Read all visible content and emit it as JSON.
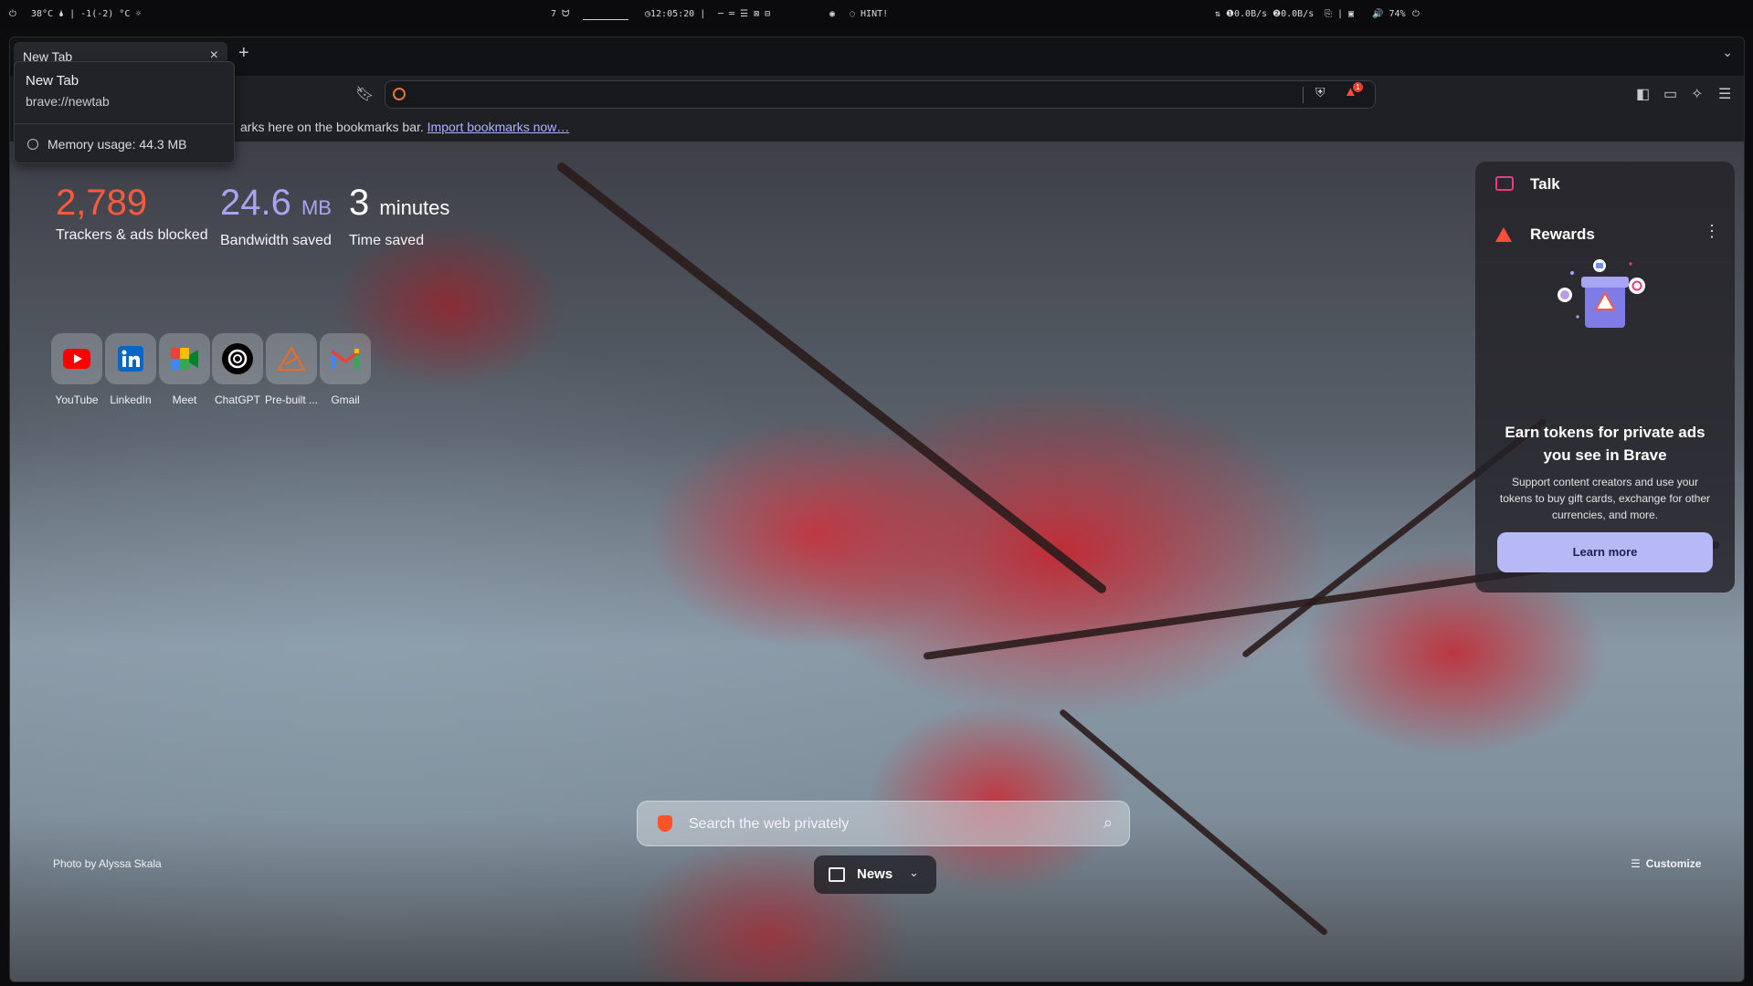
{
  "system_bar": {
    "power_icon": "power-icon",
    "temperature": "38°C 🌢 | -1(-2) °C ☼",
    "workspace_number": "7 ᗢ",
    "clock": "◷12:05:20 |",
    "workspace_dots": "─   ═   ☰   ⊠   ⊟",
    "hint": "◌ HINT!",
    "network": "⇅ ❶0.0B/s ❷0.0B/s",
    "battery": "🔊 74%",
    "power_right_icon": "power-icon"
  },
  "browser": {
    "tab": {
      "title": "New Tab",
      "close_icon": "close-icon"
    },
    "new_tab_icon": "plus-icon",
    "tab_menu_icon": "chevron-down-icon",
    "address_bar": {
      "value": "",
      "placeholder": ""
    },
    "reward_badge_count": "1",
    "bookmarks_bar": {
      "message": "arks here on the bookmarks bar.",
      "import_link": "Import bookmarks now…"
    }
  },
  "tab_tooltip": {
    "title": "New Tab",
    "url": "brave://newtab",
    "memory": "Memory usage: 44.3 MB"
  },
  "stats": [
    {
      "value": "2,789",
      "unit": "",
      "label": "Trackers & ads blocked",
      "color": "#ff5a3c"
    },
    {
      "value": "24.6",
      "unit": "MB",
      "label": "Bandwidth saved",
      "color": "#a8a5f0"
    },
    {
      "value": "3",
      "unit": "minutes",
      "label": "Time saved",
      "color": "#ffffff"
    }
  ],
  "top_sites": [
    {
      "name": "YouTube",
      "icon": "youtube-icon"
    },
    {
      "name": "LinkedIn",
      "icon": "linkedin-icon"
    },
    {
      "name": "Meet",
      "icon": "meet-icon"
    },
    {
      "name": "ChatGPT",
      "icon": "chatgpt-icon"
    },
    {
      "name": "Pre-built ...",
      "icon": "prebuilt-icon"
    },
    {
      "name": "Gmail",
      "icon": "gmail-icon"
    }
  ],
  "widgets": {
    "talk": {
      "title": "Talk"
    },
    "rewards": {
      "title": "Rewards",
      "headline": "Earn tokens for private ads you see in Brave",
      "body": "Support content creators and use your tokens to buy gift cards, exchange for other currencies, and more.",
      "cta": "Learn more"
    }
  },
  "search": {
    "placeholder": "Search the web privately"
  },
  "news_button": {
    "label": "News"
  },
  "photo_credit": "Photo by Alyssa Skala",
  "customize_label": "Customize"
}
